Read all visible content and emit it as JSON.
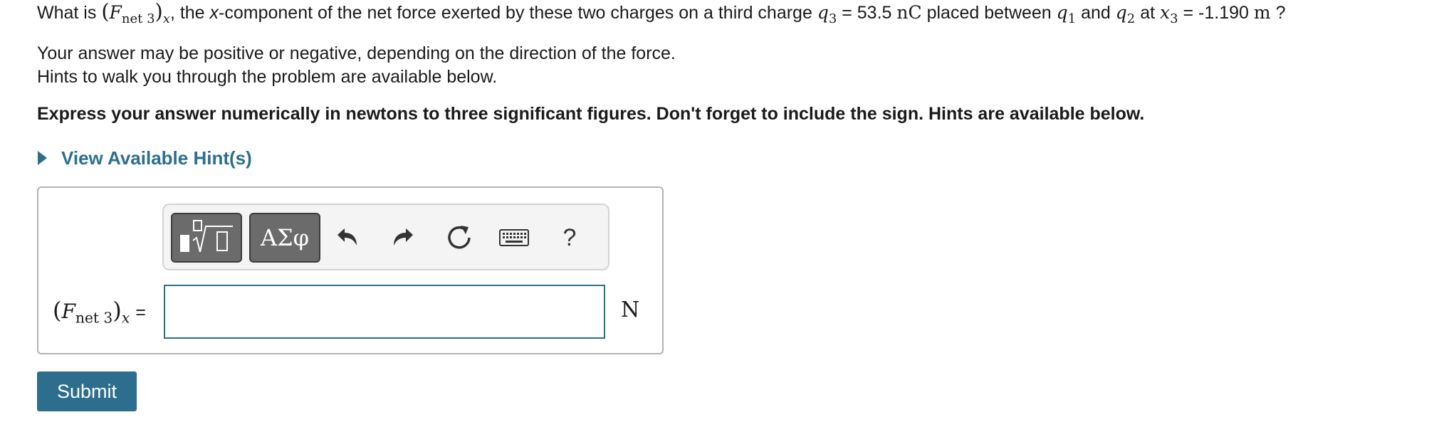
{
  "question": {
    "what_is": "What is",
    "force_symbol": "F",
    "force_subscript": "net 3",
    "force_component": "x",
    "desc_before_x": ", the",
    "x_word": "x",
    "desc_after_x": "-component of the net force exerted by these two charges on a third charge",
    "q3_symbol": "q",
    "q3_subscript": "3",
    "q3_equals": "= 53.5",
    "q3_unit": "nC",
    "placed_between": "placed between",
    "q1_symbol": "q",
    "q1_subscript": "1",
    "and_text": "and",
    "q2_symbol": "q",
    "q2_subscript": "2",
    "at_text": "at",
    "x3_symbol": "x",
    "x3_subscript": "3",
    "x3_equals": "= -1.190",
    "x3_unit": "m",
    "question_mark": "?"
  },
  "paragraphs": [
    "Your answer may be positive or negative, depending on the direction of the force.",
    "Hints to walk you through the problem are available below."
  ],
  "instruction": "Express your answer numerically in newtons to three significant figures. Don't forget to include the sign. Hints are available below.",
  "hint_link": "View Available Hint(s)",
  "toolbar": {
    "symbols_label": "ΑΣφ",
    "help_label": "?",
    "icons": [
      "templates-icon",
      "greek-symbols-icon",
      "undo-icon",
      "redo-icon",
      "reset-icon",
      "keyboard-icon",
      "help-icon"
    ]
  },
  "answer": {
    "label_symbol": "F",
    "label_subscript": "net 3",
    "label_component": "x",
    "equals": "=",
    "value": "",
    "unit": "N"
  },
  "submit_label": "Submit",
  "colors": {
    "accent": "#2d6e8e",
    "toolbar_button": "#6b6b6b"
  }
}
